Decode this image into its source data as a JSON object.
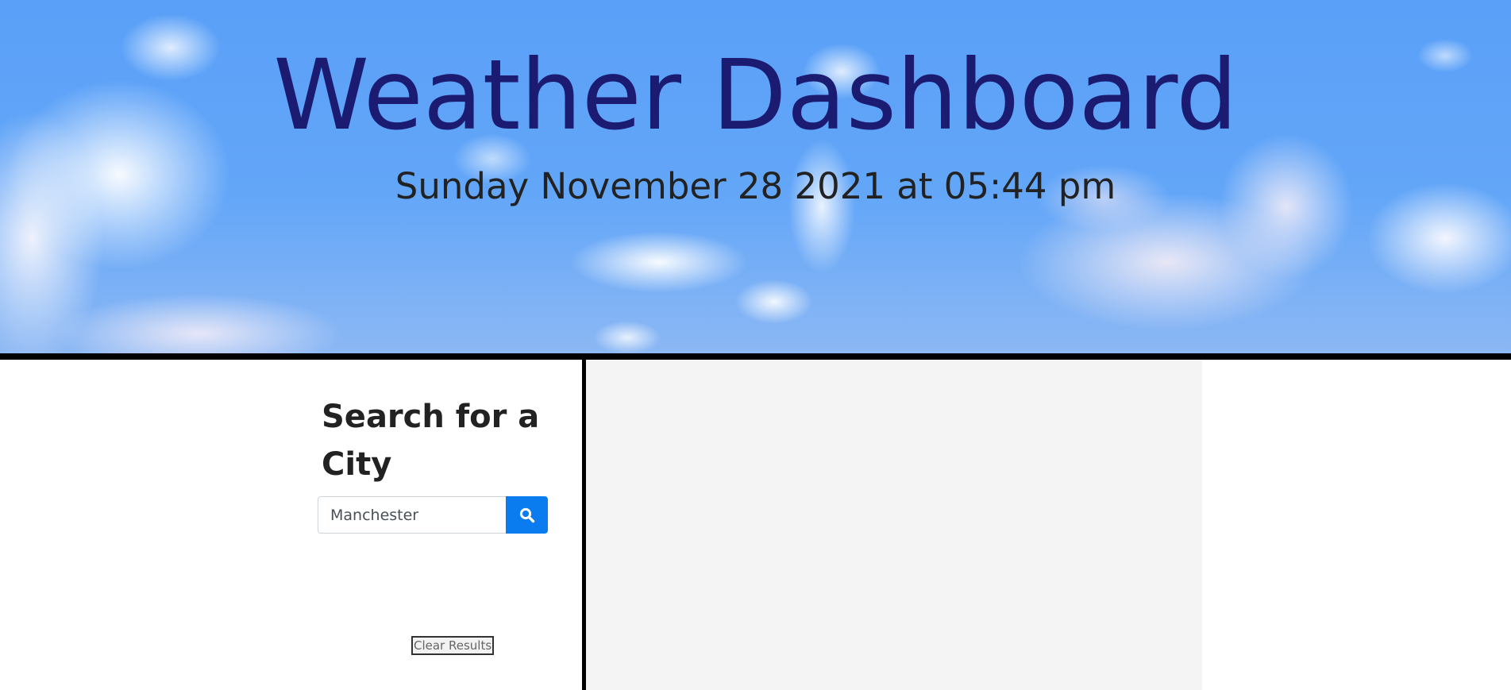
{
  "header": {
    "title": "Weather Dashboard",
    "datetime": "Sunday November 28 2021 at 05:44 pm"
  },
  "search": {
    "heading": "Search for a City",
    "input_value": "Manchester",
    "button_icon": "search-icon",
    "clear_label": "Clear Results"
  },
  "colors": {
    "title": "#1b1b72",
    "search_button": "#0b7bf0",
    "divider": "#000000",
    "results_background": "#f4f4f4"
  }
}
